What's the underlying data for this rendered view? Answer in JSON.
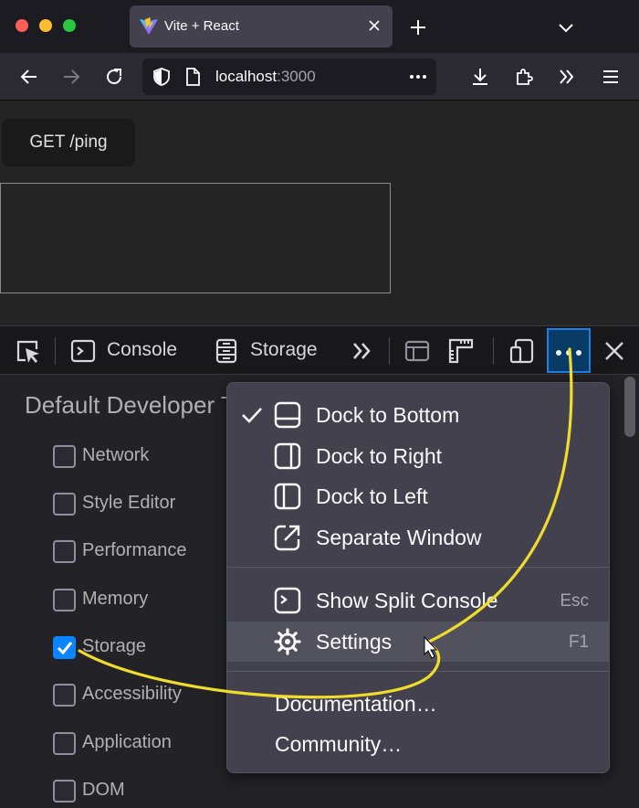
{
  "browser": {
    "tab": {
      "title": "Vite + React",
      "favicon": "vite-logo-icon"
    },
    "url": {
      "host": "localhost",
      "port": ":3000"
    }
  },
  "page": {
    "ping_button": "GET /ping"
  },
  "devtools": {
    "tabs": [
      {
        "label": "Console",
        "icon": "console-icon"
      },
      {
        "label": "Storage",
        "icon": "storage-icon"
      }
    ],
    "settings": {
      "section_title": "Default Developer Tools",
      "options": [
        {
          "label": "Network",
          "checked": false
        },
        {
          "label": "Style Editor",
          "checked": false
        },
        {
          "label": "Performance",
          "checked": false
        },
        {
          "label": "Memory",
          "checked": false
        },
        {
          "label": "Storage",
          "checked": true
        },
        {
          "label": "Accessibility",
          "checked": false
        },
        {
          "label": "Application",
          "checked": false
        },
        {
          "label": "DOM",
          "checked": false
        }
      ]
    },
    "menu": {
      "items": [
        {
          "label": "Dock to Bottom",
          "icon": "dock-bottom-icon",
          "checked": true
        },
        {
          "label": "Dock to Right",
          "icon": "dock-right-icon"
        },
        {
          "label": "Dock to Left",
          "icon": "dock-left-icon"
        },
        {
          "label": "Separate Window",
          "icon": "separate-window-icon"
        },
        {
          "label": "Show Split Console",
          "icon": "split-console-icon",
          "shortcut": "Esc"
        },
        {
          "label": "Settings",
          "icon": "gear-icon",
          "shortcut": "F1",
          "hovered": true
        },
        {
          "label": "Documentation…"
        },
        {
          "label": "Community…"
        }
      ]
    }
  },
  "colors": {
    "annotation": "#f0dc2d",
    "accent": "#0a84ff"
  }
}
